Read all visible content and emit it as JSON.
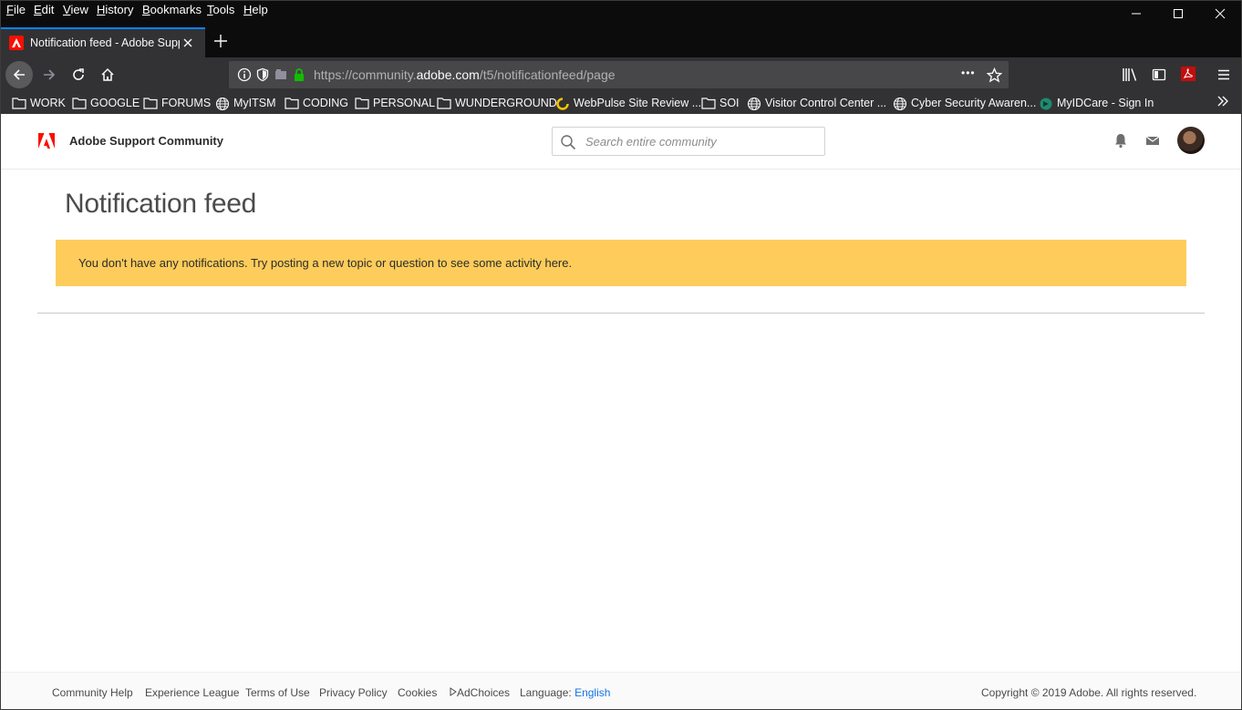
{
  "menubar": {
    "items": [
      "File",
      "Edit",
      "View",
      "History",
      "Bookmarks",
      "Tools",
      "Help"
    ]
  },
  "window_controls": {
    "minimize": "—",
    "maximize": "☐",
    "close": "✕"
  },
  "tab": {
    "title": "Notification feed - Adobe Support Community",
    "close": "✕",
    "new_tab": "+"
  },
  "urlbar": {
    "prefix": "https://community.",
    "domain": "adobe.com",
    "path": "/t5/notificationfeed/page",
    "more": "•••"
  },
  "bookmarks": [
    {
      "label": "WORK",
      "icon": "folder-icon"
    },
    {
      "label": "GOOGLE",
      "icon": "folder-icon"
    },
    {
      "label": "FORUMS",
      "icon": "folder-icon"
    },
    {
      "label": "MyITSM",
      "icon": "globe-icon"
    },
    {
      "label": "CODING",
      "icon": "folder-icon"
    },
    {
      "label": "PERSONAL",
      "icon": "folder-icon"
    },
    {
      "label": "WUNDERGROUND",
      "icon": "folder-icon"
    },
    {
      "label": "WebPulse Site Review ...",
      "icon": "webpulse-icon"
    },
    {
      "label": "SOI",
      "icon": "folder-icon"
    },
    {
      "label": "Visitor Control Center ...",
      "icon": "globe-icon"
    },
    {
      "label": "Cyber Security Awaren...",
      "icon": "globe-icon"
    },
    {
      "label": "MyIDCare - Sign In",
      "icon": "myidcare-icon"
    }
  ],
  "site": {
    "brand": "Adobe Support Community",
    "search_placeholder": "Search entire community"
  },
  "main": {
    "title": "Notification feed",
    "alert": "You don't have any notifications. Try posting a new topic or question to see some activity here."
  },
  "footer": {
    "links": [
      "Community Help",
      "Experience League",
      "Terms of Use",
      "Privacy Policy",
      "Cookies",
      "AdChoices"
    ],
    "language_label": "Language:",
    "language_value": "English",
    "copyright": "Copyright © 2019 Adobe. All rights reserved."
  },
  "colors": {
    "adobe_red": "#fa0f00",
    "alert_bg": "#fdcc5b",
    "link_blue": "#1473e6",
    "chrome_dark": "#0c0c0d"
  }
}
